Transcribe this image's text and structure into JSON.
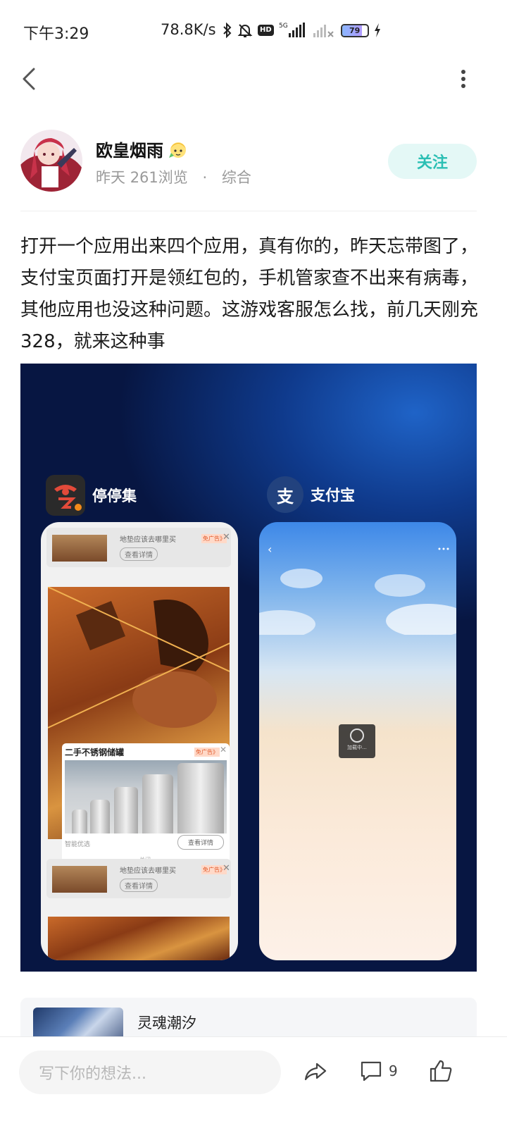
{
  "status_bar": {
    "time": "下午3:29",
    "net_speed": "78.8K/s",
    "network": "5G",
    "hd": "HD",
    "battery": "79"
  },
  "post": {
    "author": "欧皇烟雨",
    "date": "昨天",
    "views": "261浏览",
    "separator": "·",
    "category": "综合",
    "follow_label": "关注",
    "text": "打开一个应用出来四个应用，真有你的，昨天忘带图了，支付宝页面打开是领红包的，手机管家查不出来有病毒，其他应用也没这种问题。这游戏客服怎么找，前几天刚充328，就来这种事"
  },
  "screenshot": {
    "app_a": {
      "name": "停停集",
      "icon": "app-logo-icon"
    },
    "app_b": {
      "name": "支付宝",
      "icon_char": "支"
    },
    "ad_title": "地垫应该去哪里买",
    "ad_button": "查看详情",
    "ad_tag": "免广告》",
    "popup_title": "二手不锈钢储罐",
    "popup_source": "智能优选",
    "popup_button": "查看详情",
    "popup_close": "关闭",
    "loading_text": "加载中..."
  },
  "related": {
    "title": "灵魂潮汐"
  },
  "bottom_bar": {
    "input_placeholder": "写下你的想法...",
    "comment_count": "9"
  },
  "colors": {
    "accent": "#2bbfb4",
    "follow_bg": "#e4f8f6",
    "text": "#1c1c1c",
    "muted": "#9a9a9a"
  }
}
